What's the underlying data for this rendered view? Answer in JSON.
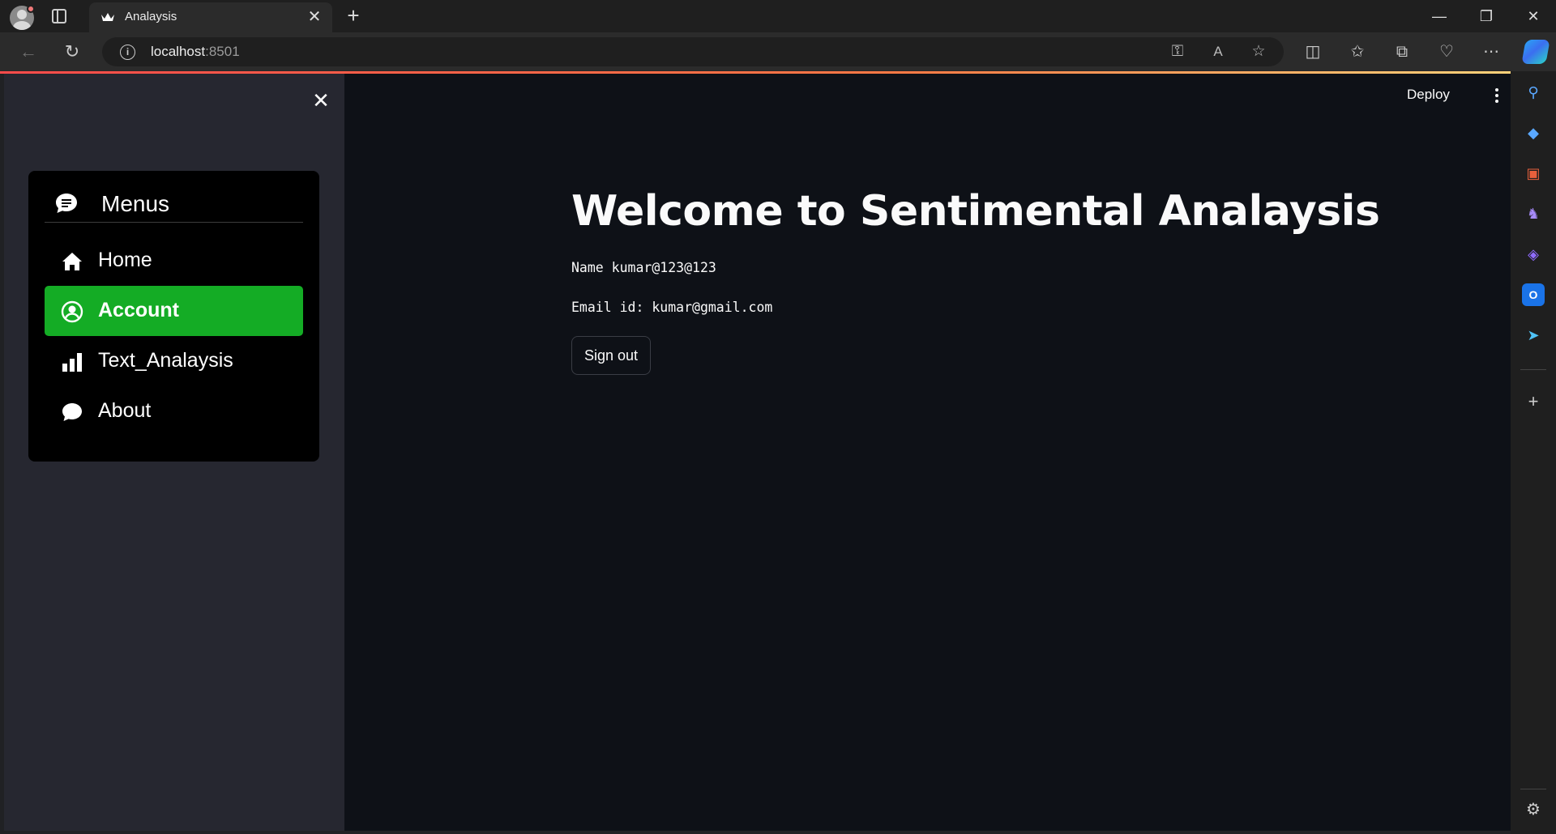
{
  "browser": {
    "tab_title": "Analaysis",
    "url_host": "localhost",
    "url_port": ":8501",
    "new_tab_glyph": "+",
    "close_tab_glyph": "✕",
    "minimize_glyph": "—",
    "restore_glyph": "❐",
    "close_glyph": "✕",
    "icons": [
      "back-icon",
      "refresh-icon",
      "info-icon",
      "key-icon",
      "read-aloud-icon",
      "favorite-star-icon",
      "split-screen-icon",
      "favorites-icon",
      "collections-icon",
      "browser-essentials-icon",
      "more-icon",
      "copilot-icon"
    ]
  },
  "app": {
    "deploy_label": "Deploy",
    "sidebar_close_glyph": "✕",
    "menu": {
      "title": "Menus",
      "items": [
        {
          "label": "Home",
          "icon": "house-icon",
          "active": false
        },
        {
          "label": "Account",
          "icon": "person-circle-icon",
          "active": true
        },
        {
          "label": "Text_Analaysis",
          "icon": "bar-chart-icon",
          "active": false
        },
        {
          "label": "About",
          "icon": "chat-bubble-icon",
          "active": false
        }
      ]
    },
    "heading": "Welcome to Sentimental Analaysis",
    "name_line": "Name kumar@123@123",
    "email_line": "Email id: kumar@gmail.com",
    "signout_label": "Sign out"
  },
  "colors": {
    "page_bg": "#0e1117",
    "sidebar_bg": "#262730",
    "menu_bg": "#000000",
    "active_item": "#14ac25"
  },
  "edge_sidebar": {
    "icons": [
      "search-icon",
      "shopping-tag-icon",
      "tools-icon",
      "games-icon",
      "copilot-app-icon",
      "outlook-icon",
      "telegram-icon",
      "add-icon",
      "settings-icon"
    ]
  }
}
